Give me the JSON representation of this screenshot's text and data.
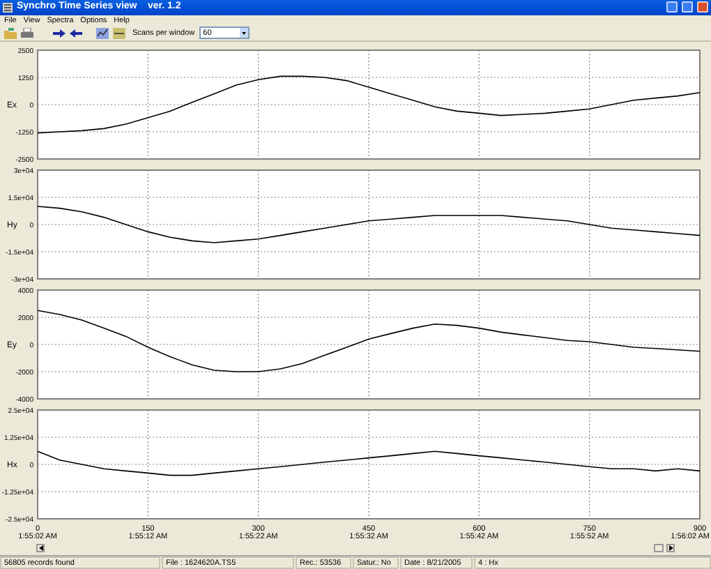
{
  "window": {
    "title": "Synchro Time Series view    ver. 1.2"
  },
  "menu": [
    "File",
    "View",
    "Spectra",
    "Options",
    "Help"
  ],
  "toolbar": {
    "scans_label": "Scans per window",
    "scans_value": "60"
  },
  "channels": [
    {
      "chart_data": {
        "type": "line",
        "grid": true,
        "xlim": [
          0,
          900
        ],
        "ylim": [
          -2500,
          2500
        ],
        "yticks": [
          {
            "value": 2500,
            "label": "2500"
          },
          {
            "value": 1250,
            "label": "1250"
          },
          {
            "value": 0,
            "label": "0"
          },
          {
            "value": -1250,
            "label": "-1250"
          },
          {
            "value": -2500,
            "label": "-2500"
          }
        ],
        "x": [
          0,
          30,
          60,
          90,
          120,
          150,
          180,
          210,
          240,
          270,
          300,
          330,
          360,
          390,
          420,
          450,
          480,
          510,
          540,
          570,
          600,
          630,
          660,
          690,
          720,
          750,
          780,
          810,
          840,
          870,
          900
        ],
        "series": [
          {
            "name": "Ex",
            "color": "#000000",
            "values": [
              -1300,
              -1250,
              -1200,
              -1100,
              -900,
              -600,
              -300,
              100,
              500,
              900,
              1150,
              1300,
              1300,
              1250,
              1100,
              800,
              500,
              200,
              -100,
              -300,
              -400,
              -500,
              -450,
              -400,
              -300,
              -200,
              0,
              200,
              300,
              400,
              550
            ]
          }
        ]
      }
    },
    {
      "chart_data": {
        "type": "line",
        "grid": true,
        "xlim": [
          0,
          900
        ],
        "ylim": [
          -30000,
          30000
        ],
        "yticks": [
          {
            "value": 30000,
            "label": "3e+04"
          },
          {
            "value": 15000,
            "label": "1.5e+04"
          },
          {
            "value": 0,
            "label": "0"
          },
          {
            "value": -15000,
            "label": "-1.5e+04"
          },
          {
            "value": -30000,
            "label": "-3e+04"
          }
        ],
        "x": [
          0,
          30,
          60,
          90,
          120,
          150,
          180,
          210,
          240,
          270,
          300,
          330,
          360,
          390,
          420,
          450,
          480,
          510,
          540,
          570,
          600,
          630,
          660,
          690,
          720,
          750,
          780,
          810,
          840,
          870,
          900
        ],
        "series": [
          {
            "name": "Hy",
            "color": "#000000",
            "values": [
              10000,
              9000,
              7000,
              4000,
              0,
              -4000,
              -7000,
              -9000,
              -10000,
              -9000,
              -8000,
              -6000,
              -4000,
              -2000,
              0,
              2000,
              3000,
              4000,
              5000,
              5000,
              5000,
              5000,
              4000,
              3000,
              2000,
              0,
              -2000,
              -3000,
              -4000,
              -5000,
              -6000
            ]
          }
        ]
      }
    },
    {
      "chart_data": {
        "type": "line",
        "grid": true,
        "xlim": [
          0,
          900
        ],
        "ylim": [
          -4000,
          4000
        ],
        "yticks": [
          {
            "value": 4000,
            "label": "4000"
          },
          {
            "value": 2000,
            "label": "2000"
          },
          {
            "value": 0,
            "label": "0"
          },
          {
            "value": -2000,
            "label": "-2000"
          },
          {
            "value": -4000,
            "label": "-4000"
          }
        ],
        "x": [
          0,
          30,
          60,
          90,
          120,
          150,
          180,
          210,
          240,
          270,
          300,
          330,
          360,
          390,
          420,
          450,
          480,
          510,
          540,
          570,
          600,
          630,
          660,
          690,
          720,
          750,
          780,
          810,
          840,
          870,
          900
        ],
        "series": [
          {
            "name": "Ey",
            "color": "#000000",
            "values": [
              2500,
              2200,
              1800,
              1200,
              600,
              -200,
              -900,
              -1500,
              -1900,
              -2000,
              -2000,
              -1800,
              -1400,
              -800,
              -200,
              400,
              800,
              1200,
              1500,
              1400,
              1200,
              900,
              700,
              500,
              300,
              200,
              0,
              -200,
              -300,
              -400,
              -500
            ]
          }
        ]
      }
    },
    {
      "chart_data": {
        "type": "line",
        "grid": true,
        "xlim": [
          0,
          900
        ],
        "ylim": [
          -25000,
          25000
        ],
        "xticks": [
          0,
          150,
          300,
          450,
          600,
          750,
          900
        ],
        "yticks": [
          {
            "value": 25000,
            "label": "2.5e+04"
          },
          {
            "value": 12500,
            "label": "1.25e+04"
          },
          {
            "value": 0,
            "label": "0"
          },
          {
            "value": -12500,
            "label": "-1.25e+04"
          },
          {
            "value": -25000,
            "label": "-2.5e+04"
          }
        ],
        "x": [
          0,
          30,
          60,
          90,
          120,
          150,
          180,
          210,
          240,
          270,
          300,
          330,
          360,
          390,
          420,
          450,
          480,
          510,
          540,
          570,
          600,
          630,
          660,
          690,
          720,
          750,
          780,
          810,
          840,
          870,
          900
        ],
        "series": [
          {
            "name": "Hx",
            "color": "#000000",
            "values": [
              6000,
              2000,
              0,
              -2000,
              -3000,
              -4000,
              -5000,
              -5000,
              -4000,
              -3000,
              -2000,
              -1000,
              0,
              1000,
              2000,
              3000,
              4000,
              5000,
              6000,
              5000,
              4000,
              3000,
              2000,
              1000,
              0,
              -1000,
              -2000,
              -2000,
              -3000,
              -2000,
              -3000
            ]
          }
        ]
      }
    }
  ],
  "time_axis": [
    "1:55:02 AM",
    "1:55:12 AM",
    "1:55:22 AM",
    "1:55:32 AM",
    "1:55:42 AM",
    "1:55:52 AM",
    "1:56:02 AM"
  ],
  "status_bar": [
    "56805 records found",
    "File : 1624620A.TS5",
    "Rec.: 53536",
    "Satur.: No",
    "Date : 8/21/2005",
    "4 : Hx"
  ]
}
